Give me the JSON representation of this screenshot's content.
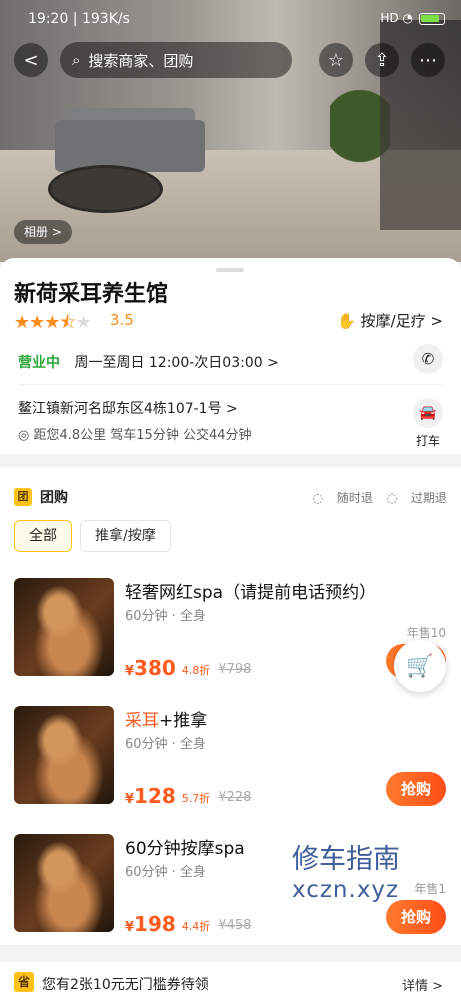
{
  "status_bar": {
    "time": "19:20",
    "net_speed": "193K/s",
    "signal": "HD",
    "battery": "74"
  },
  "header": {
    "search_placeholder": "搜索商家、团购",
    "back": "<",
    "fav": "☆",
    "share": "⇪",
    "more": "⋯"
  },
  "album_label": "相册 >",
  "shop": {
    "name": "新荷采耳养生馆",
    "rating": "3.5",
    "category": "按摩/足疗 >",
    "open_status": "营业中",
    "hours": "周一至周日 12:00-次日03:00 >",
    "address": "鳌江镇新河名邸东区4栋107-1号 >",
    "distance": "距您4.8公里  驾车15分钟  公交44分钟",
    "taxi_label": "打车"
  },
  "group": {
    "icon": "团",
    "title": "团购",
    "tags": [
      "随时退",
      "过期退"
    ],
    "tabs": [
      "全部",
      "推拿/按摩"
    ],
    "deals": [
      {
        "title": "轻奢网红spa（请提前电话预约）",
        "sub": "60分钟 · 全身",
        "currency": "¥",
        "price": "380",
        "discount": "4.8折",
        "orig": "¥798",
        "sales": "年售10",
        "buy": "抢购"
      },
      {
        "title": "采耳+推拿",
        "sub": "60分钟 · 全身",
        "currency": "¥",
        "price": "128",
        "discount": "5.7折",
        "orig": "¥228",
        "sales": "",
        "buy": "抢购"
      },
      {
        "title": "60分钟按摩spa",
        "sub": "60分钟 · 全身",
        "currency": "¥",
        "price": "198",
        "discount": "4.4折",
        "orig": "¥458",
        "sales": "年售1",
        "buy": "抢购"
      }
    ]
  },
  "watermark": {
    "line1": "修车指南",
    "line2": "xczn.xyz"
  },
  "coupon": {
    "icon": "省",
    "text": "您有2张10元无门槛券待领",
    "detail": "详情 >"
  },
  "colors": {
    "accent": "#ff5a1f",
    "star": "#ff8c1a",
    "open": "#2aa53a",
    "tag": "#ffc21a"
  }
}
